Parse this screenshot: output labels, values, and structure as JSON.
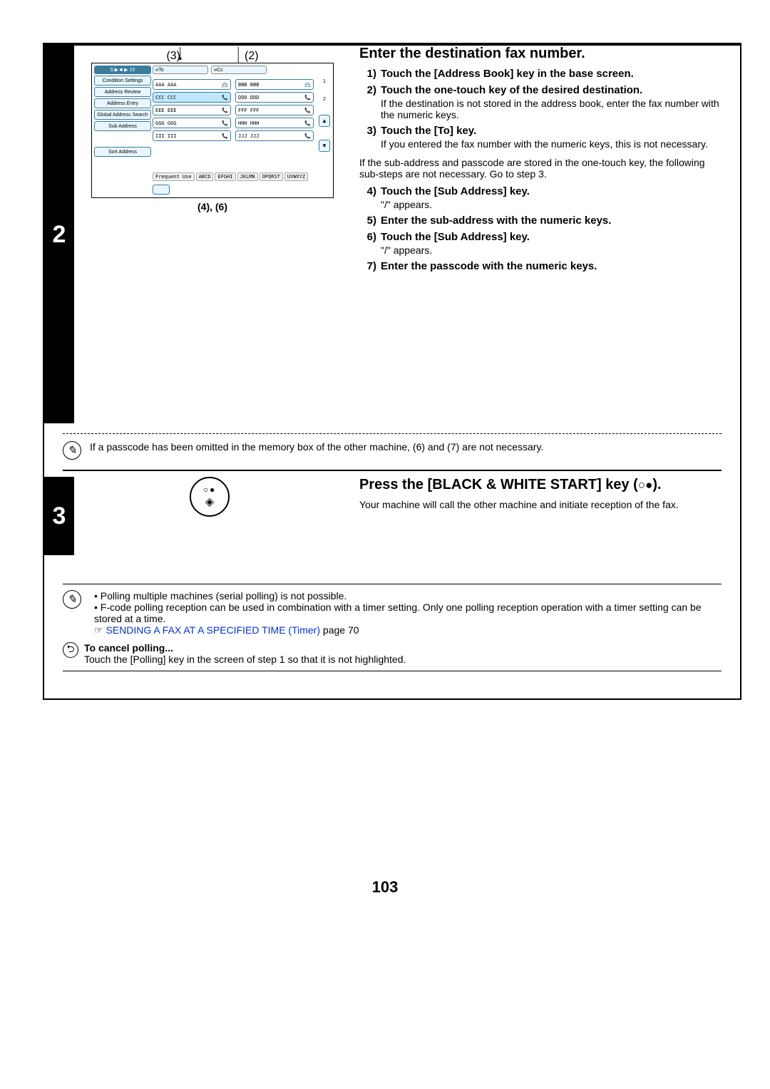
{
  "page_number": "103",
  "step2": {
    "num": "2",
    "title": "Enter the destination fax number.",
    "callout_top_left": "(3)",
    "callout_top_right": "(2)",
    "callout_bottom": "(4), (6)",
    "diagram": {
      "top_bar": "5 ▶ ■ ▶ 15",
      "left_buttons": [
        "Condition Settings",
        "Address Review",
        "Address Entry",
        "Global Address Search",
        "Sub Address",
        "Sort Address"
      ],
      "tabs": [
        "To",
        "Cc"
      ],
      "entries": [
        "AAA AAA",
        "BBB BBB",
        "CCC CCC",
        "DDD DDD",
        "EEE EEE",
        "FFF FFF",
        "GGG GGG",
        "HHH HHH",
        "III III",
        "JJJ JJJ"
      ],
      "side_nums": [
        "1",
        "2"
      ],
      "freq": "Frequent Use",
      "alpha": [
        "ABCD",
        "EFGHI",
        "JKLMN",
        "OPQRST",
        "UVWXYZ"
      ]
    },
    "s1_num": "1)",
    "s1": "Touch the [Address Book] key in the base screen.",
    "s2_num": "2)",
    "s2": "Touch the one-touch key of the desired destination.",
    "s2_note": "If the destination is not stored in the address book, enter the fax number with the numeric keys.",
    "s3_num": "3)",
    "s3": "Touch the [To] key.",
    "s3_note": "If you entered the fax number with the numeric keys, this is not necessary.",
    "midnote": "If the sub-address and passcode are stored in the one-touch key, the following sub-steps are not necessary. Go to step 3.",
    "s4_num": "4)",
    "s4": "Touch the [Sub Address] key.",
    "s4_note": "\"/\" appears.",
    "s5_num": "5)",
    "s5": "Enter the sub-address with the numeric keys.",
    "s6_num": "6)",
    "s6": "Touch the [Sub Address] key.",
    "s6_note": "\"/\" appears.",
    "s7_num": "7)",
    "s7": "Enter the passcode with the numeric keys.",
    "dashed_note": "If a passcode has been omitted in the memory box of the other machine, (6) and (7) are not necessary."
  },
  "step3": {
    "num": "3",
    "title_a": "Press the [BLACK & WHITE START] key",
    "title_b": "(",
    "title_c": ").",
    "symbol_dots": "○●",
    "symbol_diamond": "◈",
    "note": "Your machine will call the other machine and initiate reception of the fax."
  },
  "footer_notes": {
    "b1": "Polling multiple machines (serial polling) is not possible.",
    "b2": "F-code polling reception can be used in combination with a timer setting. Only one polling reception operation with a timer setting can be stored at a time.",
    "link_prefix": "☞",
    "link_text": "SENDING A FAX AT A SPECIFIED TIME (Timer)",
    "link_page": " page 70",
    "cancel_title": "To cancel polling...",
    "cancel_body": "Touch the [Polling] key in the screen of step 1 so that it is not highlighted."
  }
}
